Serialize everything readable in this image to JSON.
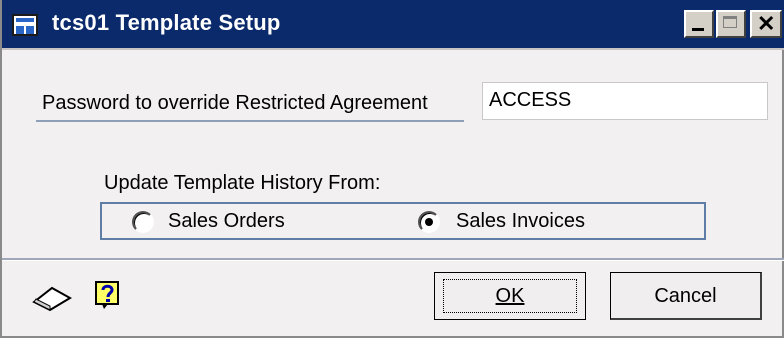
{
  "window": {
    "title": "tcs01 Template Setup",
    "icon": "window-form-icon",
    "controls": [
      "minimize-icon",
      "maximize-icon",
      "close-icon"
    ]
  },
  "form": {
    "password_label": "Password to override Restricted Agreement",
    "password_value": "ACCESS",
    "group_label": "Update Template History From:",
    "options": [
      {
        "label": "Sales Orders",
        "checked": false
      },
      {
        "label": "Sales Invoices",
        "checked": true
      }
    ]
  },
  "footer": {
    "note_icon": "note-icon",
    "help_icon": "help-icon",
    "ok_label": "OK",
    "cancel_label": "Cancel"
  }
}
